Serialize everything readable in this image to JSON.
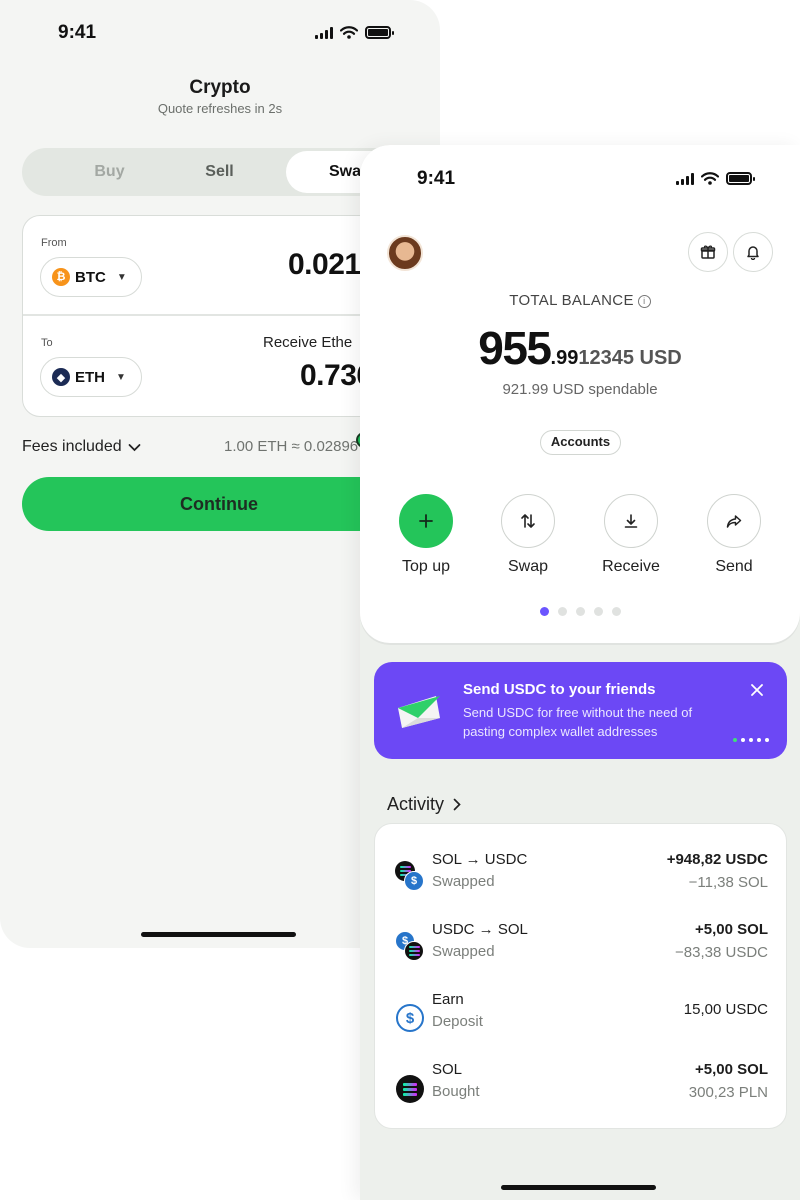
{
  "back_screen": {
    "status": {
      "time": "9:41"
    },
    "title": "Crypto",
    "subtitle": "Quote refreshes in 2s",
    "tabs": [
      {
        "label": "Buy",
        "selected": false
      },
      {
        "label": "Sell",
        "selected": false
      },
      {
        "label": "Swa",
        "selected": true
      }
    ],
    "from": {
      "label": "From",
      "coin": "BTC",
      "coin_icon": "bitcoin-icon",
      "amount": "0.0213"
    },
    "to": {
      "label": "To",
      "coin": "ETH",
      "coin_icon": "ethereum-icon",
      "receive_label": "Receive Ethe",
      "amount": "0.736"
    },
    "fees_label": "Fees included",
    "rate": "1.00 ETH ≈ 0.02896",
    "continue_label": "Continue",
    "colors": {
      "accent": "#24c55a",
      "segment_bg": "#e3e7e2"
    }
  },
  "front_screen": {
    "status": {
      "time": "9:41"
    },
    "header_icons": [
      "avatar",
      "gift-icon",
      "bell-icon"
    ],
    "total_balance_label": "TOTAL BALANCE",
    "balance": {
      "main": "955",
      "cents": ".99",
      "rest": "12345 USD"
    },
    "spendable": "921.99 USD spendable",
    "accounts_label": "Accounts",
    "actions": [
      {
        "label": "Top up",
        "icon": "plus-icon",
        "primary": true
      },
      {
        "label": "Swap",
        "icon": "swap-arrows-icon",
        "primary": false
      },
      {
        "label": "Receive",
        "icon": "download-icon",
        "primary": false
      },
      {
        "label": "Send",
        "icon": "share-arrow-icon",
        "primary": false
      }
    ],
    "pager": {
      "count": 5,
      "active": 0
    },
    "promo": {
      "title": "Send USDC to your friends",
      "body": "Send USDC for free without the need of pasting complex wallet addresses",
      "color": "#6c48f5"
    },
    "activity_label": "Activity",
    "activity": [
      {
        "title": "SOL → USDC",
        "subtitle": "Swapped",
        "value": "+948,82 USDC",
        "secondary": "−11,38 SOL",
        "icon": "sol-usdc-icon"
      },
      {
        "title": "USDC → SOL",
        "subtitle": "Swapped",
        "value": "+5,00 SOL",
        "secondary": "−83,38 USDC",
        "icon": "usdc-sol-icon"
      },
      {
        "title": "Earn",
        "subtitle": "Deposit",
        "value": "15,00 USDC",
        "secondary": "",
        "icon": "usdc-icon"
      },
      {
        "title": "SOL",
        "subtitle": "Bought",
        "value": "+5,00 SOL",
        "secondary": "300,23 PLN",
        "icon": "solana-icon"
      }
    ]
  }
}
